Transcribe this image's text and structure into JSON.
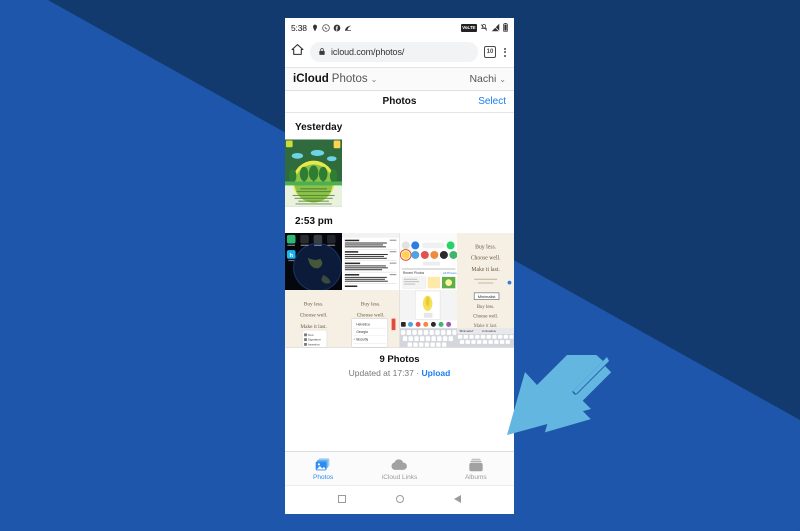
{
  "background": {
    "dark_blue": "#123a6e",
    "mid_blue": "#1d56ab",
    "arrow_color": "#63b6e0"
  },
  "phone": {
    "statusbar": {
      "time": "5:38",
      "left_icons": [
        "location-icon",
        "whatsapp-icon",
        "facebook-icon",
        "app-icon"
      ],
      "right_icons": [
        "volte-badge",
        "vibrate-mute-icon",
        "signal-bars-icon",
        "battery-icon"
      ],
      "volte_label": "VoLTE"
    },
    "browser": {
      "home_icon": "home-icon",
      "lock_icon": "lock-icon",
      "url": "icloud.com/photos/",
      "tab_count": "10",
      "menu_icon": "kebab-menu-icon"
    },
    "icloud_header": {
      "brand": "iCloud",
      "app": "Photos",
      "app_chevron": "⌄",
      "account": "Nachi",
      "account_chevron": "⌄"
    },
    "photos_nav": {
      "title": "Photos",
      "select_label": "Select"
    },
    "sections": [
      {
        "header": "Yesterday",
        "photos": [
          {
            "name": "green-nature-poster",
            "kind": "poster-green"
          }
        ]
      },
      {
        "header": "2:53 pm",
        "photos": [
          {
            "name": "phone-homescreen-earth",
            "kind": "homescreen"
          },
          {
            "name": "text-document-screenshot",
            "kind": "document"
          },
          {
            "name": "emoji-picker-screenshot",
            "kind": "emoji-app"
          },
          {
            "name": "buy-less-card",
            "kind": "quote-card"
          },
          {
            "name": "buy-less-card-menu",
            "kind": "quote-card-menu"
          },
          {
            "name": "buy-less-card-dropdown",
            "kind": "quote-card-dropdown"
          },
          {
            "name": "keyboard-screenshot",
            "kind": "keyboard"
          },
          {
            "name": "minimalist-card-keyboard",
            "kind": "quote-card-keyboard"
          }
        ]
      }
    ],
    "quote_card": {
      "line1": "Buy less.",
      "line2": "Choose well.",
      "line3": "Make it last.",
      "tag": "Minimalist"
    },
    "summary": {
      "count": "9 Photos",
      "updated_prefix": "Updated at 17:37",
      "separator": "·",
      "upload_label": "Upload"
    },
    "tabbar": [
      {
        "label": "Photos",
        "icon": "photos-stack-icon",
        "active": true
      },
      {
        "label": "iCloud Links",
        "icon": "cloud-icon",
        "active": false
      },
      {
        "label": "Albums",
        "icon": "albums-icon",
        "active": false
      }
    ],
    "android_nav": [
      {
        "name": "recents-button",
        "icon": "square-icon"
      },
      {
        "name": "home-button",
        "icon": "circle-icon"
      },
      {
        "name": "back-button",
        "icon": "triangle-icon"
      }
    ]
  },
  "annotation": {
    "arrow_name": "pointer-arrow-to-albums",
    "points_at": "Albums"
  }
}
